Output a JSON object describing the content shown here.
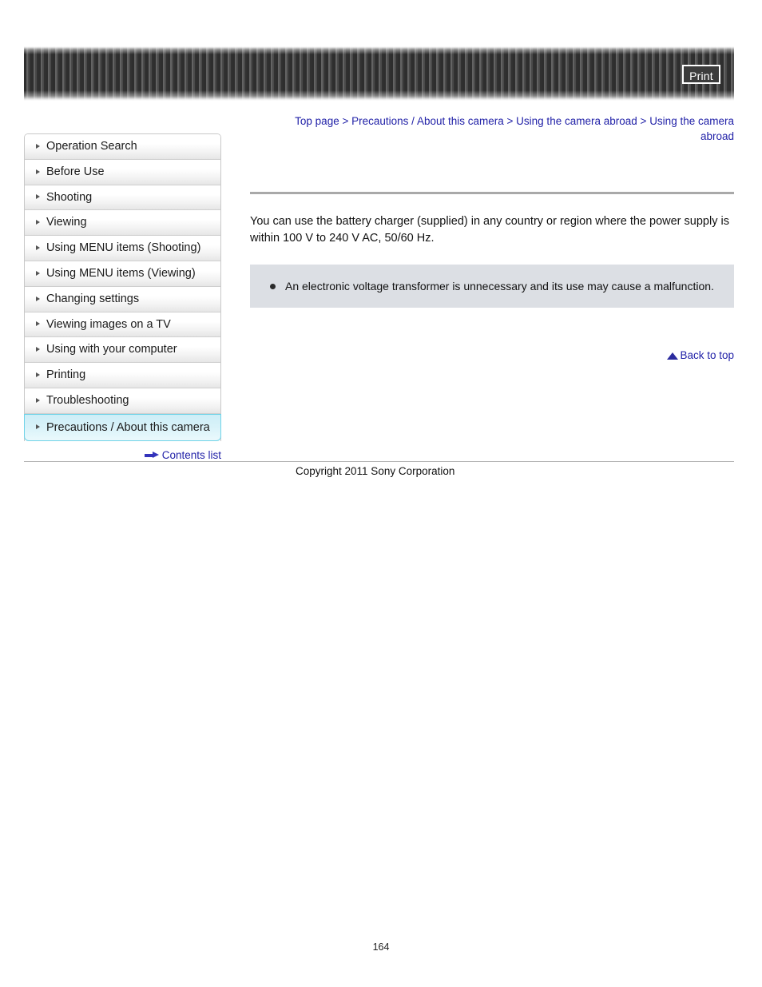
{
  "header": {
    "print_label": "Print",
    "print_icon": "printer-icon",
    "banner_color": "#3a3a3a"
  },
  "breadcrumb": {
    "separator": ">",
    "items": [
      {
        "label": "Top page"
      },
      {
        "label": "Precautions / About this camera"
      },
      {
        "label": "Using the camera abroad"
      },
      {
        "label": "Using the camera abroad"
      }
    ],
    "link_color": "#2222a8"
  },
  "sidebar": {
    "items": [
      {
        "label": "Operation Search",
        "active": false
      },
      {
        "label": "Before Use",
        "active": false
      },
      {
        "label": "Shooting",
        "active": false
      },
      {
        "label": "Viewing",
        "active": false
      },
      {
        "label": "Using MENU items (Shooting)",
        "active": false
      },
      {
        "label": "Using MENU items (Viewing)",
        "active": false
      },
      {
        "label": "Changing settings",
        "active": false
      },
      {
        "label": "Viewing images on a TV",
        "active": false
      },
      {
        "label": "Using with your computer",
        "active": false
      },
      {
        "label": "Printing",
        "active": false
      },
      {
        "label": "Troubleshooting",
        "active": false
      },
      {
        "label": "Precautions / About this camera",
        "active": true
      }
    ],
    "contents_list_label": "Contents list",
    "contents_list_icon": "arrow-right-icon",
    "active_color": "#6fd3e8"
  },
  "main": {
    "title": "",
    "body_paragraph": "You can use the battery charger (supplied) in any country or region where the power supply is within 100 V to 240 V AC, 50/60 Hz.",
    "note": {
      "bullet_icon": "bullet-dot-icon",
      "text": "An electronic voltage transformer is unnecessary and its use may cause a malfunction."
    },
    "back_to_top_label": "Back to top",
    "back_to_top_icon": "triangle-up-icon"
  },
  "footer": {
    "copyright": "Copyright 2011 Sony Corporation",
    "page_number": "164"
  }
}
